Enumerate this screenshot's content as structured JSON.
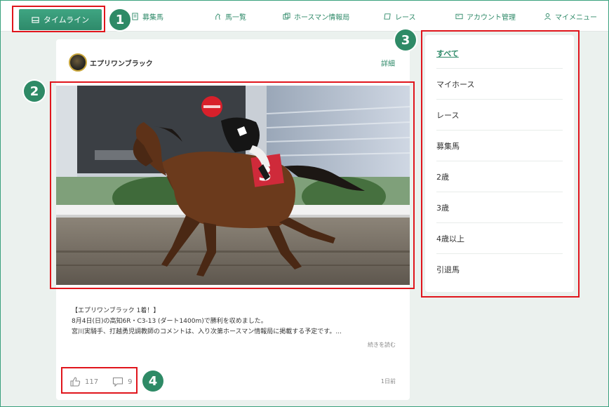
{
  "nav": {
    "items": [
      {
        "label": "タイムライン",
        "icon": "timeline-icon",
        "active": true
      },
      {
        "label": "募集馬",
        "icon": "document-icon"
      },
      {
        "label": "馬一覧",
        "icon": "horse-icon"
      },
      {
        "label": "ホースマン情報局",
        "icon": "info-icon"
      },
      {
        "label": "レース",
        "icon": "flag-icon"
      },
      {
        "label": "アカウント管理",
        "icon": "account-card-icon"
      },
      {
        "label": "マイメニュー",
        "icon": "user-icon"
      }
    ]
  },
  "annotations": [
    "1",
    "2",
    "3",
    "4"
  ],
  "post": {
    "horse_name": "エプリワンブラック",
    "detail_label": "詳細",
    "saddle_number": "3",
    "text_lines": [
      "【エプリワンブラック 1着！】",
      "8月4日(日)の高知6R・C3-13 (ダート1400m)で勝利を収めました。",
      "宮川実騎手、打越勇児調教師のコメントは、入り次第ホースマン情報局に掲載する予定です。..."
    ],
    "read_more": "続きを読む",
    "likes": "117",
    "comments": "9",
    "time": "1日前"
  },
  "sidebar": {
    "items": [
      "すべて",
      "マイホース",
      "レース",
      "募集馬",
      "2歳",
      "3歳",
      "4歳以上",
      "引退馬"
    ],
    "active_index": 0
  },
  "colors": {
    "accent": "#2f8a69",
    "highlight": "#e0151c",
    "background": "#ebf1ee"
  }
}
